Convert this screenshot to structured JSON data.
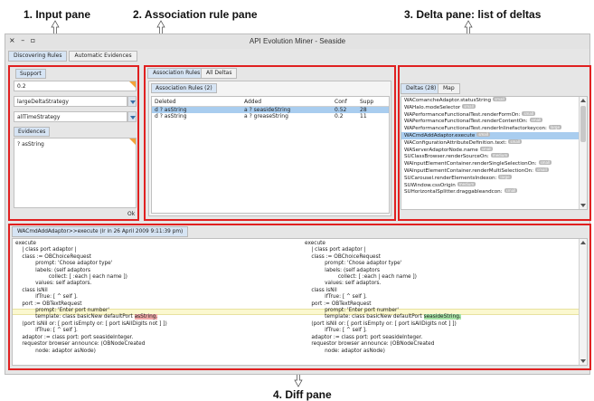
{
  "callouts": {
    "input": "1. Input pane",
    "association": "2. Association rule pane",
    "delta": "3. Delta pane: list of deltas",
    "diff": "4. Diff pane"
  },
  "window": {
    "title": "API Evolution Miner - Seaside",
    "controls": "× – ▫"
  },
  "top_tabs": [
    {
      "label": "Discovering Rules",
      "active": true
    },
    {
      "label": "Automatic Evidences",
      "active": false
    }
  ],
  "input_pane": {
    "support_tab": "Support",
    "support_value": "0.2",
    "strategy1": "largeDeltaStrategy",
    "strategy2": "allTimeStrategy",
    "evidences_tab": "Evidences",
    "evidence_item": "? asString",
    "ok_label": "Ok"
  },
  "assoc_pane": {
    "tabs": [
      {
        "label": "Association Rules",
        "active": true
      },
      {
        "label": "All Deltas",
        "active": false
      }
    ],
    "sub_tab": "Association Rules (2)",
    "columns": [
      "Deleted",
      "Added",
      "Conf",
      "Supp"
    ],
    "rows": [
      {
        "deleted": "d ? asString",
        "added": "a ? seasideString",
        "conf": "0.52",
        "supp": "28",
        "selected": true
      },
      {
        "deleted": "d ? asString",
        "added": "a ? greaseString",
        "conf": "0.2",
        "supp": "11",
        "selected": false
      }
    ]
  },
  "delta_pane": {
    "tabs": [
      {
        "label": "Deltas (28)",
        "active": true
      },
      {
        "label": "Map",
        "active": false
      }
    ],
    "items": [
      {
        "name": "WAComancheAdaptor.statusString",
        "badge": "small"
      },
      {
        "name": "WAHalo.modeSelector",
        "badge": "small"
      },
      {
        "name": "WAPerformanceFunctionalTest.renderFormOn:",
        "badge": "small"
      },
      {
        "name": "WAPerformanceFunctionalTest.renderContentOn:",
        "badge": "small"
      },
      {
        "name": "WAPerformanceFunctionalTest.renderInlinefactorkeycon:",
        "badge": "large"
      },
      {
        "name": "WACmdAddAdaptor.execute",
        "badge": "small",
        "selected": true
      },
      {
        "name": "WAConfigurationAttributeDefinition.text:",
        "badge": "small"
      },
      {
        "name": "WAServerAdaptorNode.name",
        "badge": "small"
      },
      {
        "name": "SUClassBrowser.renderSourceOn:",
        "badge": "medium"
      },
      {
        "name": "WAInputElementContainer.renderSingleSelectionOn:",
        "badge": "small"
      },
      {
        "name": "WAInputElementContainer.renderMultiSelectionOn:",
        "badge": "small"
      },
      {
        "name": "SUCarousel.renderElementsIndexon:",
        "badge": "large"
      },
      {
        "name": "SUWindow.cssOrigin",
        "badge": "medium"
      },
      {
        "name": "SUHorizontalSplitter.draggableandcon:",
        "badge": "small"
      }
    ]
  },
  "diff_pane": {
    "tab": "WACmdAddAdaptor>>execute (lr in 26 April 2009 9:11:39 pm)",
    "left_lines": [
      "execute",
      "    | class port adaptor |",
      "    class := OBChoiceRequest",
      "            prompt: 'Chose adaptor type'",
      "            labels: (self adaptors",
      "                    collect: [ :each | each name ])",
      "            values: self adaptors.",
      "    class isNil",
      "            ifTrue: [ ^ self ].",
      "    port := OBTextRequest",
      "            prompt: 'Enter port number'",
      "            template: class basicNew defaultPort ",
      "    (port isNil or: [ port isEmpty or: [ port isAllDigits not ] ])",
      "            ifTrue: [ ^ self ].",
      "    adaptor := class port: port seasideInteger.",
      "    requestor browser announce: (OBNodeCreated",
      "            node: adaptor asNode)"
    ],
    "right_lines": [
      "execute",
      "    | class port adaptor |",
      "    class := OBChoiceRequest",
      "            prompt: 'Chose adaptor type'",
      "            labels: (self adaptors",
      "                    collect: [ :each | each name ])",
      "            values: self adaptors.",
      "    class isNil",
      "            ifTrue: [ ^ self ].",
      "    port := OBTextRequest",
      "            prompt: 'Enter port number'",
      "            template: class basicNew defaultPort ",
      "    (port isNil or: [ port isEmpty or: [ port isAllDigits not ] ])",
      "            ifTrue: [ ^ self ].",
      "    adaptor := class port: port seasideInteger.",
      "    requestor browser announce: (OBNodeCreated",
      "            node: adaptor asNode)"
    ],
    "deleted_token": "asString.",
    "added_token": "seasideString."
  },
  "colors": {
    "highlight": "#e02020",
    "selection": "#a9cdef",
    "deleted": "#f0a8a8",
    "added": "#a6e3a6"
  },
  "icons": {
    "dropdown": "chevron-down-icon",
    "corner": "resize-corner-icon",
    "arrow": "double-arrow-icon"
  }
}
